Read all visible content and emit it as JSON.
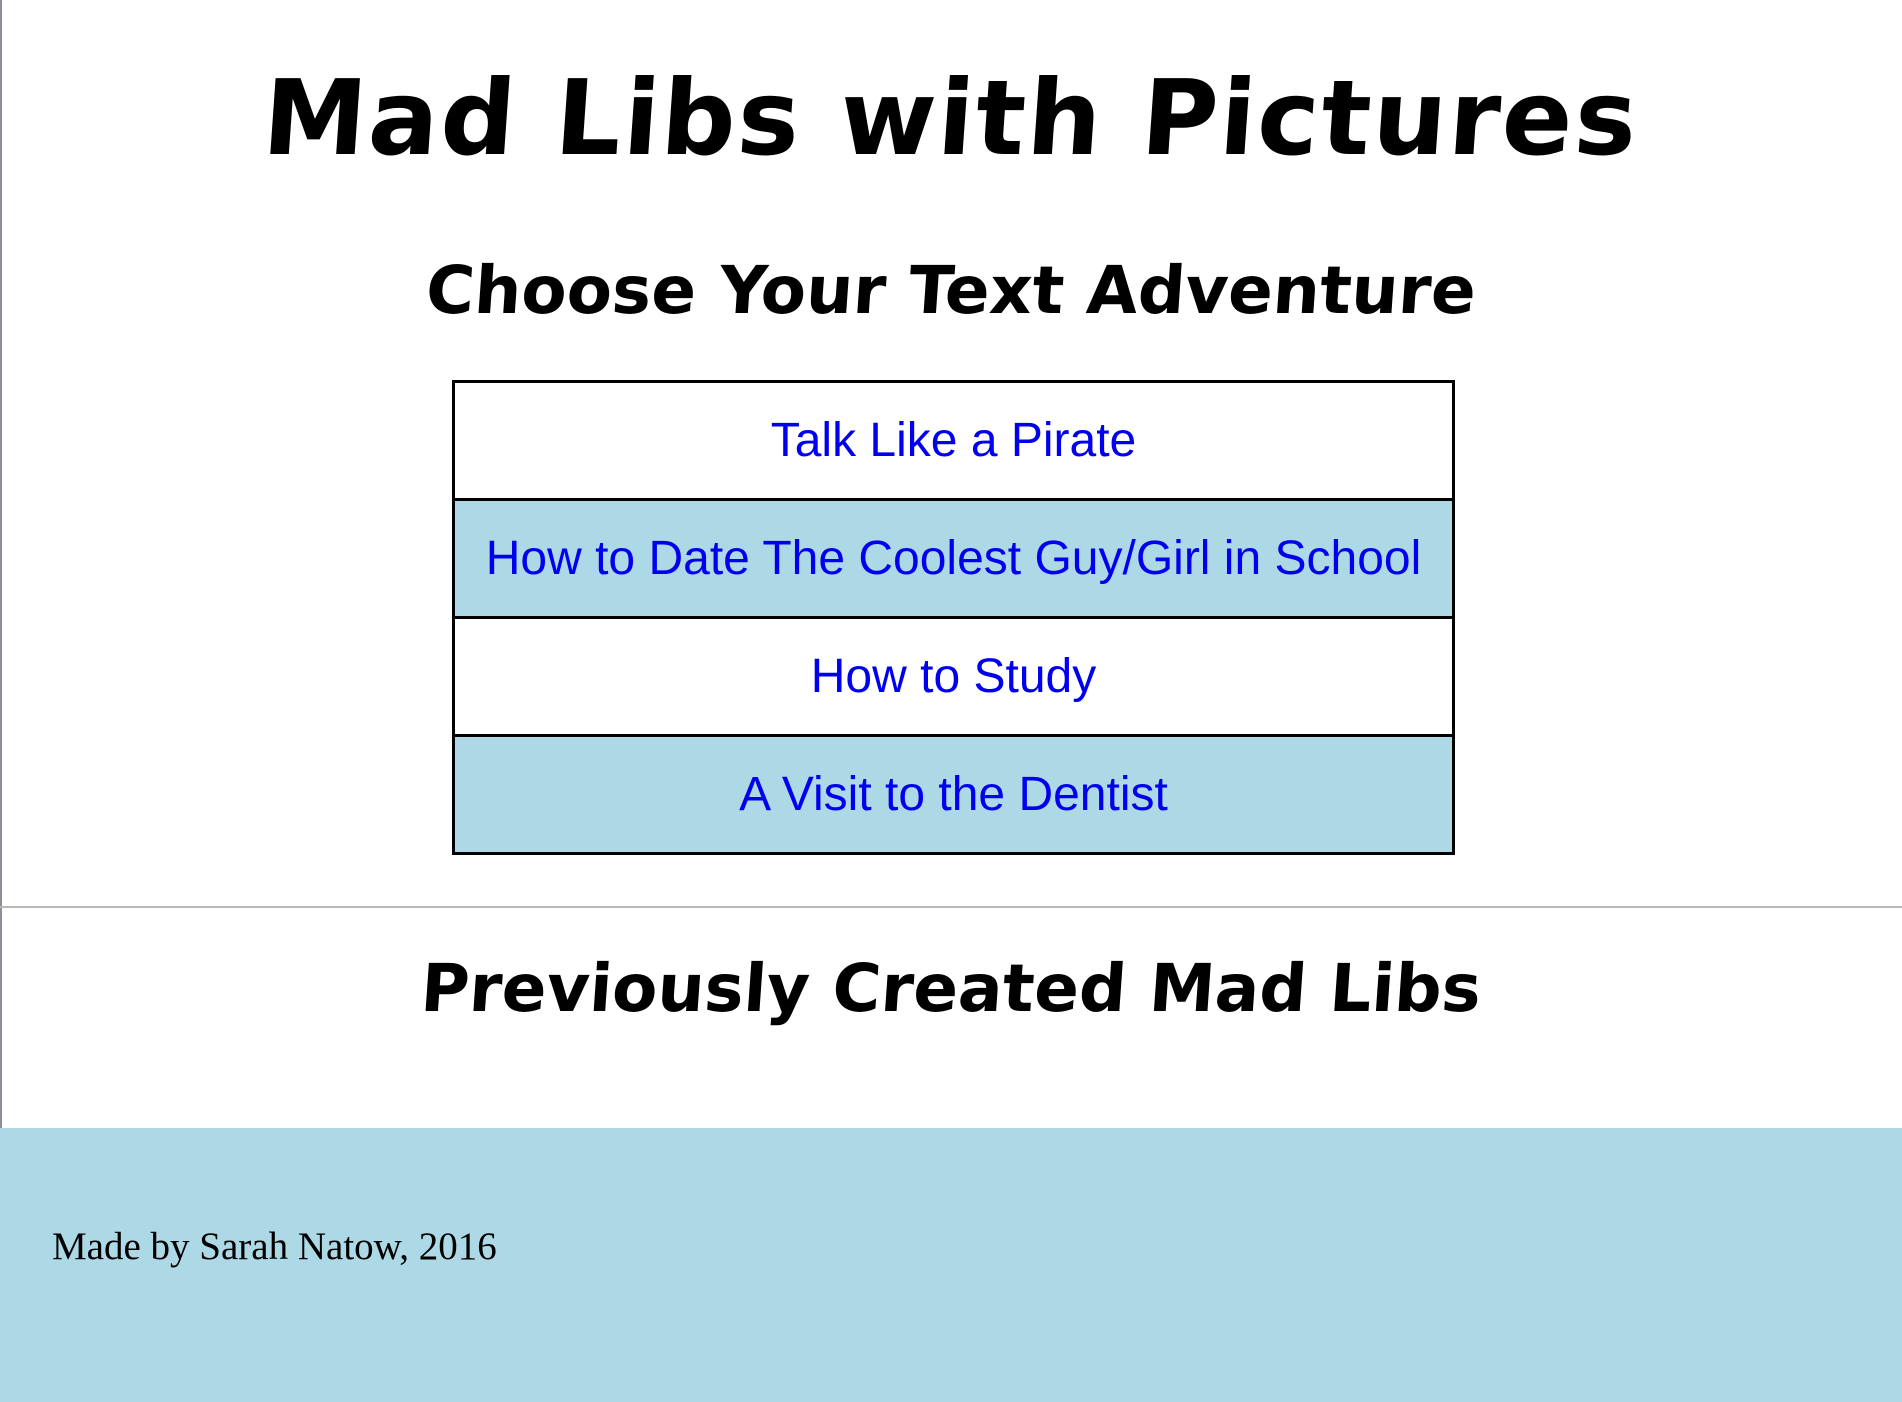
{
  "header": {
    "title": "Mad Libs with Pictures"
  },
  "choose": {
    "heading": "Choose Your Text Adventure",
    "adventures": [
      {
        "label": "Talk Like a Pirate"
      },
      {
        "label": "How to Date The Coolest Guy/Girl in School"
      },
      {
        "label": "How to Study"
      },
      {
        "label": "A Visit to the Dentist"
      }
    ]
  },
  "previous": {
    "heading": "Previously Created Mad Libs"
  },
  "footer": {
    "credit": "Made by Sarah Natow, 2016"
  },
  "colors": {
    "row_alt": "#add8e6",
    "link": "#0000ee",
    "footer_bg": "#add8e6"
  }
}
